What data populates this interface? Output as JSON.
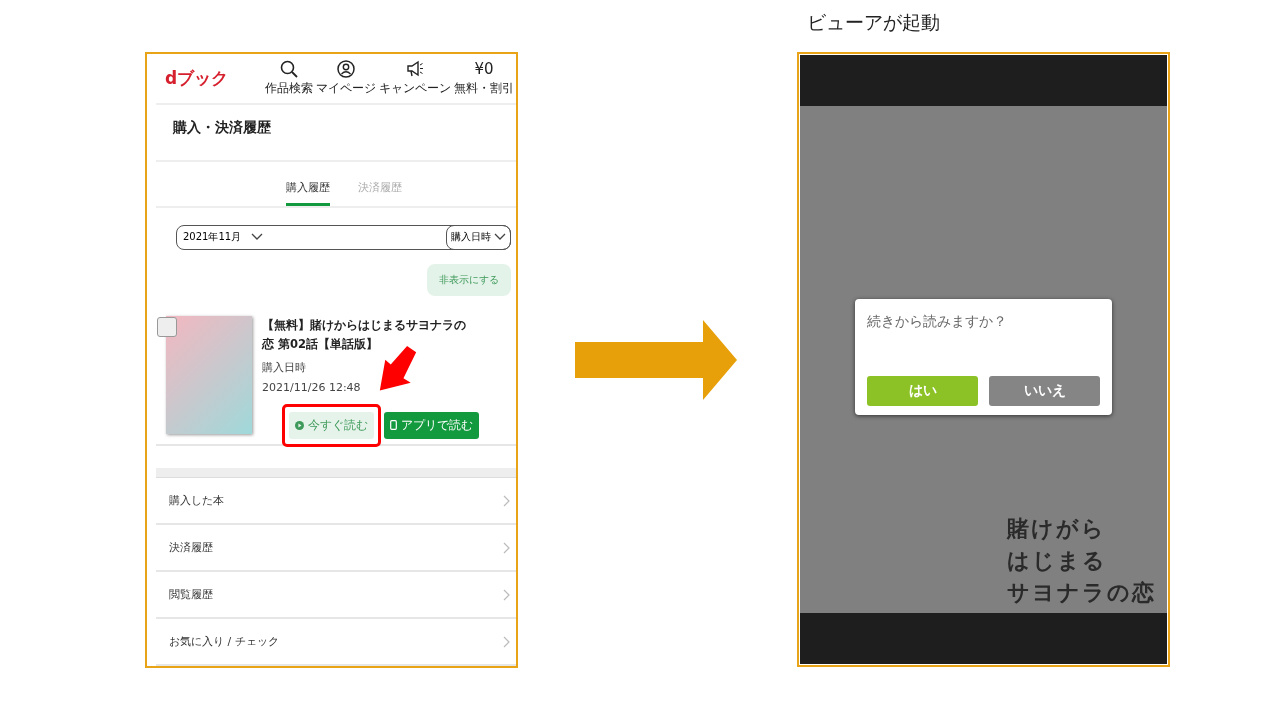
{
  "caption": "ビューアが起動",
  "store": {
    "logo": "dブック",
    "nav": [
      {
        "kind": "search",
        "label": "作品検索"
      },
      {
        "kind": "person",
        "label": "マイページ"
      },
      {
        "kind": "megaphone",
        "label": "キャンペーン"
      },
      {
        "kind": "text",
        "symbol": "¥0",
        "label": "無料・割引"
      }
    ],
    "page_title": "購入・決済履歴",
    "tabs": [
      {
        "label": "購入履歴",
        "selected": true
      },
      {
        "label": "決済履歴",
        "selected": false
      }
    ],
    "month_select": "2021年11月",
    "sort_select": "購入日時",
    "hide_button": "非表示にする",
    "item": {
      "title": "【無料】賭けからはじまるサヨナラの恋 第02話【単話版】",
      "checked": false,
      "date_label": "購入日時",
      "date": "2021/11/26 12:48",
      "read_now": "今すぐ読む",
      "read_in_app": "アプリで読む"
    },
    "menu": [
      "購入した本",
      "決済履歴",
      "閲覧履歴",
      "お気に入り / チェック"
    ]
  },
  "viewer": {
    "dialog": {
      "message": "続きから読みますか？",
      "buttons": [
        {
          "label": "はい",
          "kind": "primary"
        },
        {
          "label": "いいえ",
          "kind": "secondary"
        }
      ]
    },
    "title_lines": [
      "賭けがら",
      "はじまる",
      "サヨナラの恋"
    ]
  }
}
